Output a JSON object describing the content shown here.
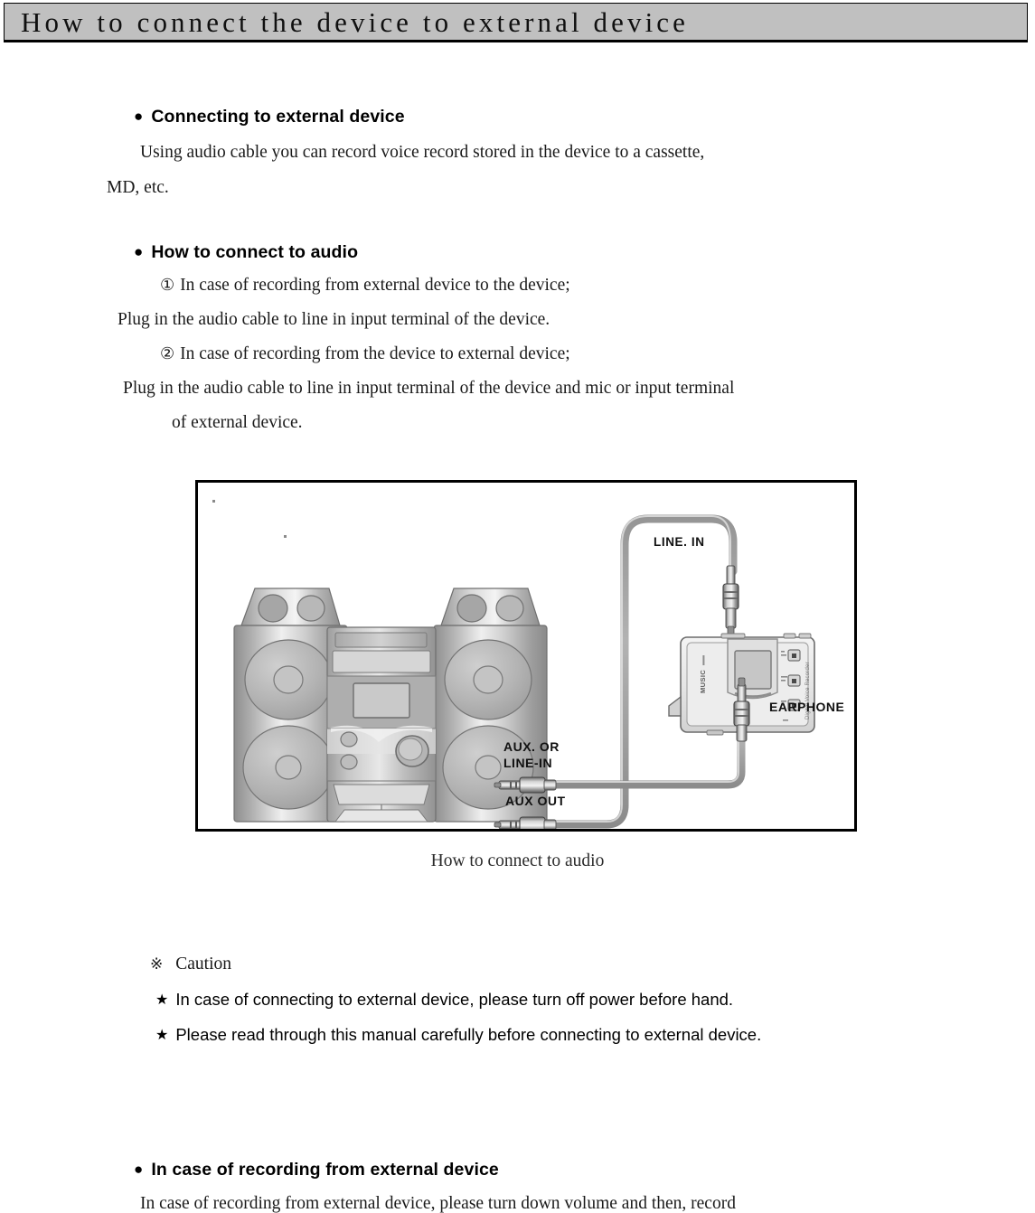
{
  "header": {
    "title": "How to connect the device to external device",
    "background_color": "#c0c0c0"
  },
  "sections": {
    "connecting": {
      "bullet": "●",
      "heading": "Connecting to external device",
      "line1": "Using audio cable you can record voice record stored in the device to a cassette,",
      "line2": "MD, etc."
    },
    "how_to_connect": {
      "bullet": "●",
      "heading": "How to connect to audio",
      "item1_num": "①",
      "item1": "In case of recording from external device to the device;",
      "item1_detail": "Plug in the audio cable to line in input terminal of the device.",
      "item2_num": "②",
      "item2": "In case of recording from the device to external device;",
      "item2_detail_a": "Plug in the audio cable to line in input terminal of the device and mic or input terminal",
      "item2_detail_b": "of external device."
    },
    "caution": {
      "mark": "※",
      "heading": "Caution",
      "star": "★",
      "items": [
        "In case of connecting to external device, please turn off power before hand.",
        "Please read through this manual carefully before connecting to external device."
      ]
    },
    "recording": {
      "bullet": "●",
      "heading": "In case of recording from external device",
      "line1": "In case of recording from external device, please turn down volume and then, record"
    }
  },
  "figure": {
    "caption": "How to connect to audio",
    "labels": {
      "line_in": "LINE. IN",
      "aux_out": "AUX OUT",
      "aux_or": "AUX. OR",
      "line_in_2": "LINE-IN",
      "earphone": "EARPHONE"
    },
    "device_labels": {
      "music": "MUSIC",
      "brand": "Digital Voice Recorder"
    }
  }
}
